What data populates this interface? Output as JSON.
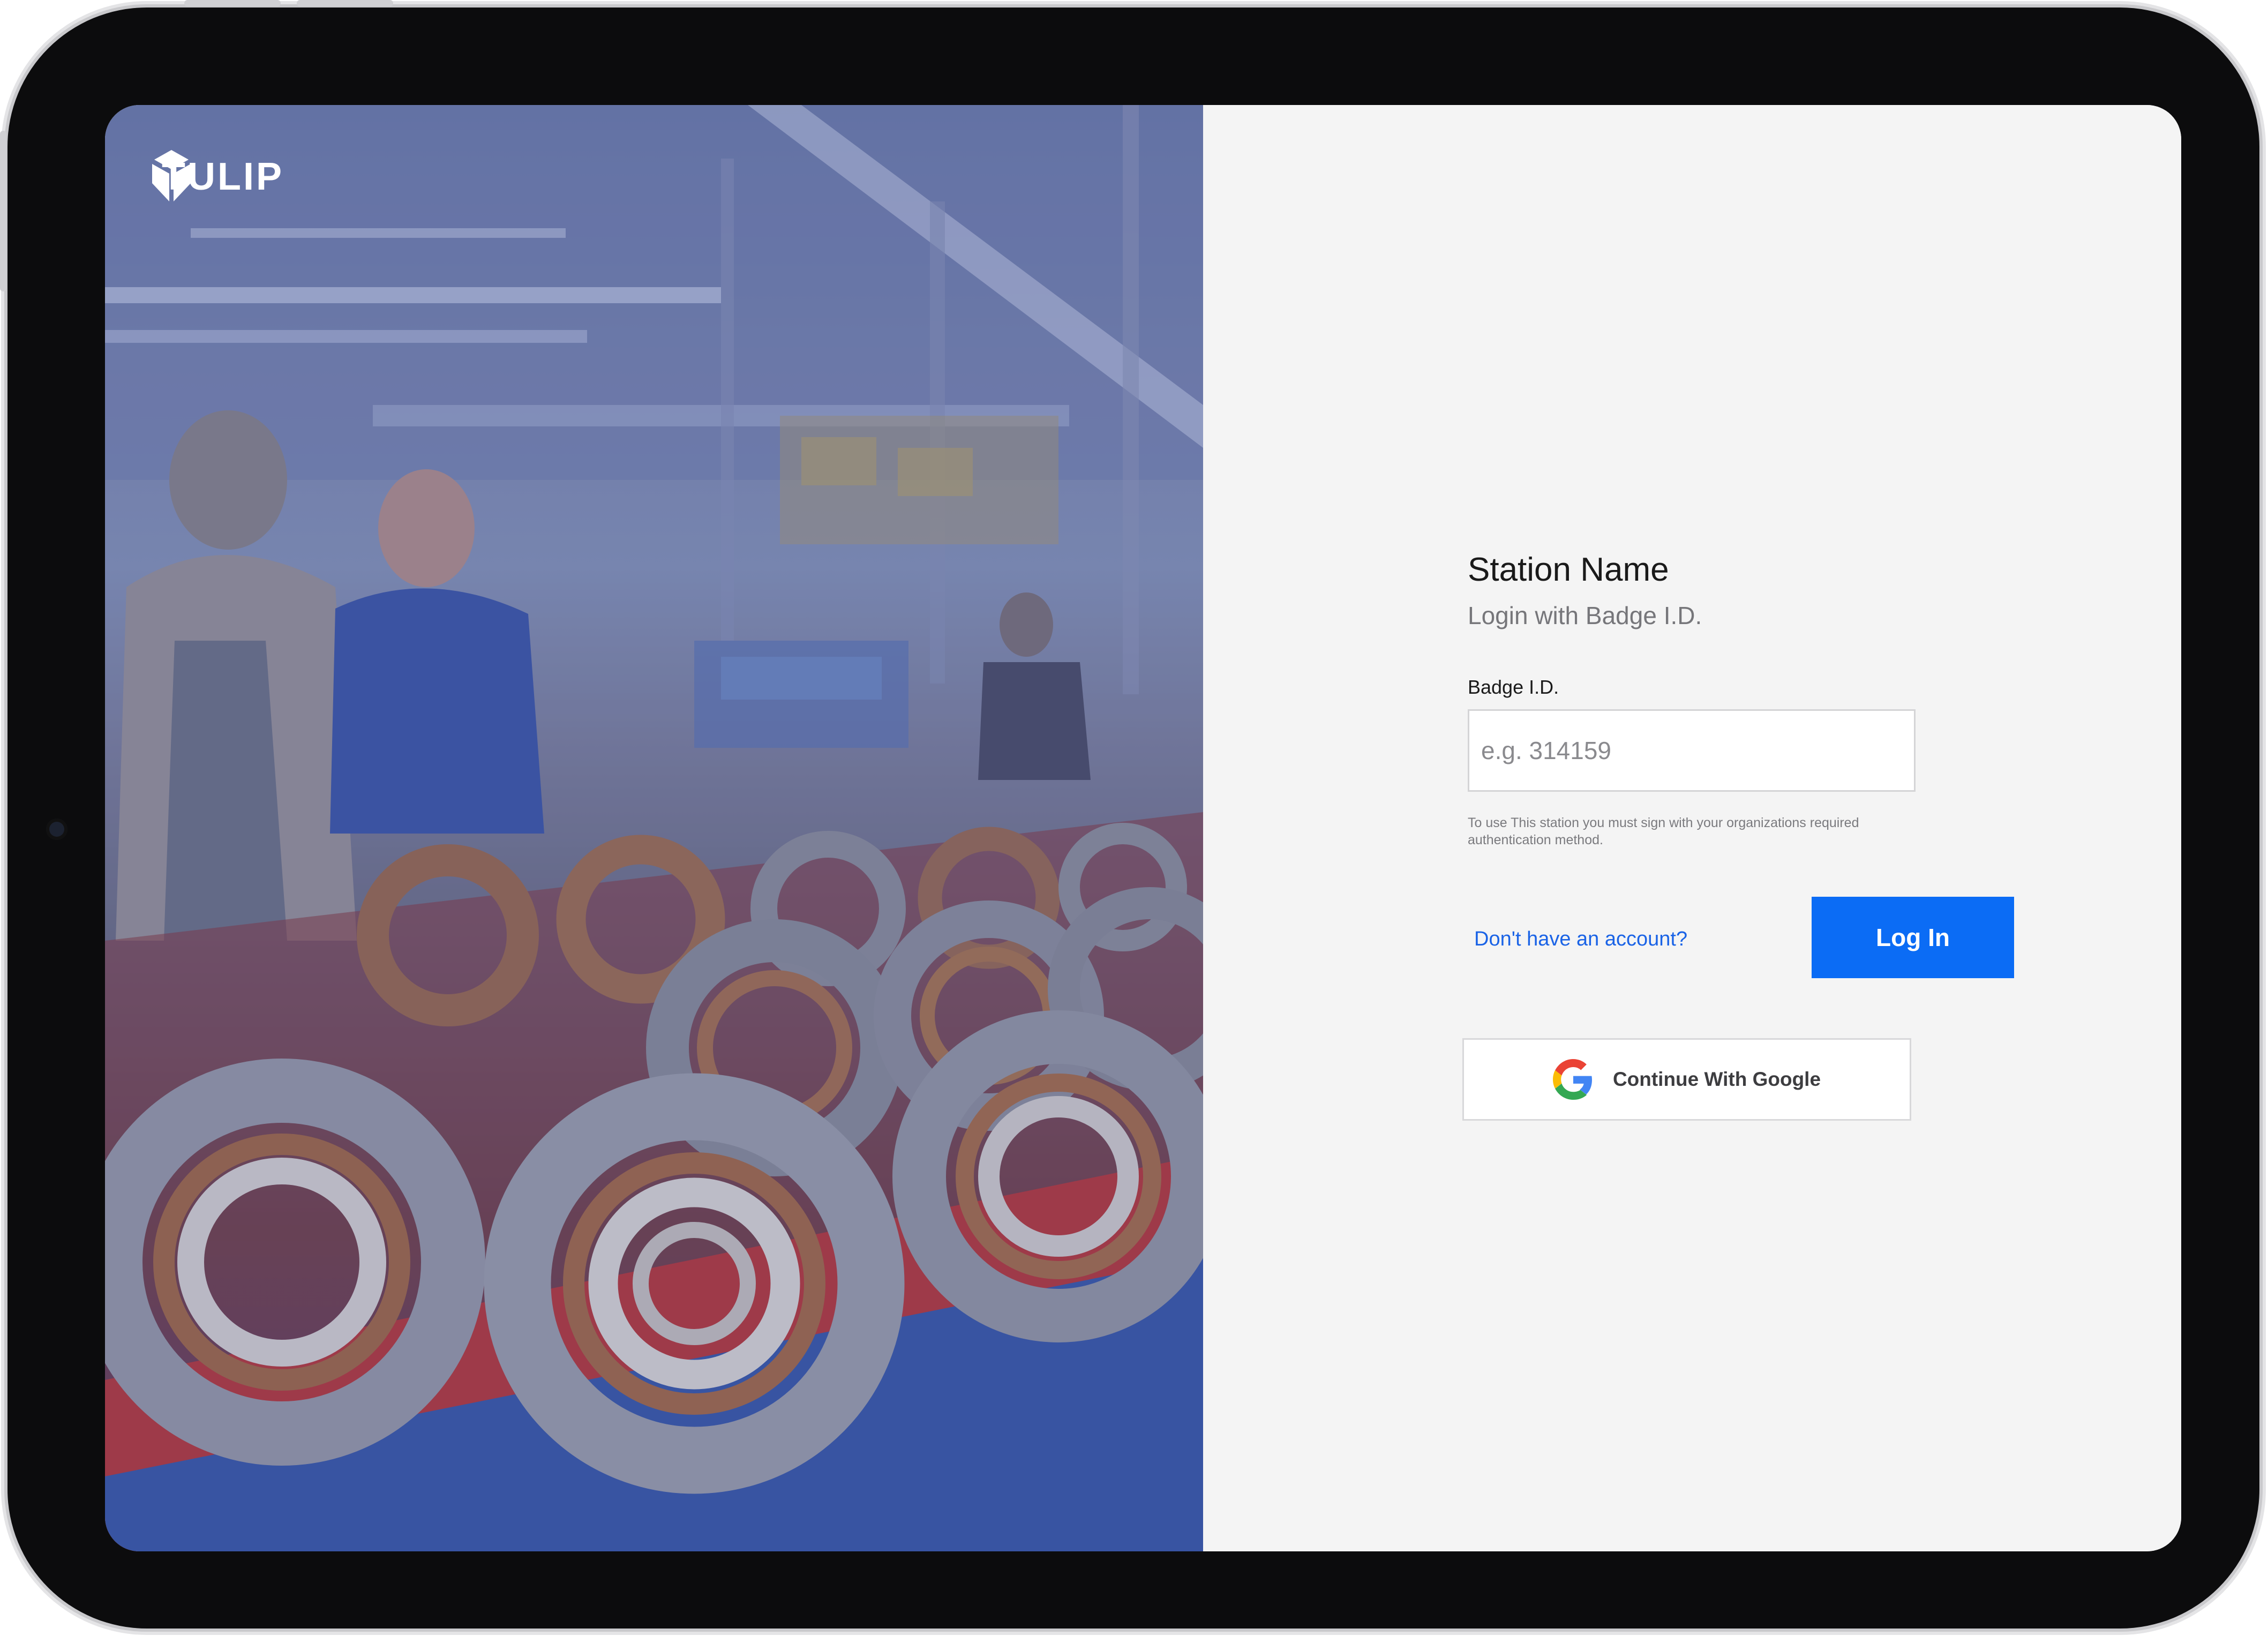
{
  "brand": {
    "name": "TULIP",
    "logo_icon": "tulip-logo-icon"
  },
  "hero_image": {
    "icon": "factory-photo"
  },
  "login": {
    "title": "Station Name",
    "subtitle": "Login with Badge I.D.",
    "badge_label": "Badge I.D.",
    "badge_placeholder": "e.g. 314159",
    "badge_value": "",
    "help_text": "To use This station you must sign with your organizations required authentication method.",
    "signup_link": "Don't have an account?",
    "login_button": "Log In",
    "google_button": "Continue With Google",
    "google_icon": "google-icon"
  },
  "colors": {
    "accent": "#0b6cf5",
    "link": "#1a63e6",
    "panel_background": "#f4f4f4",
    "device_frame": "#0c0c0d"
  }
}
